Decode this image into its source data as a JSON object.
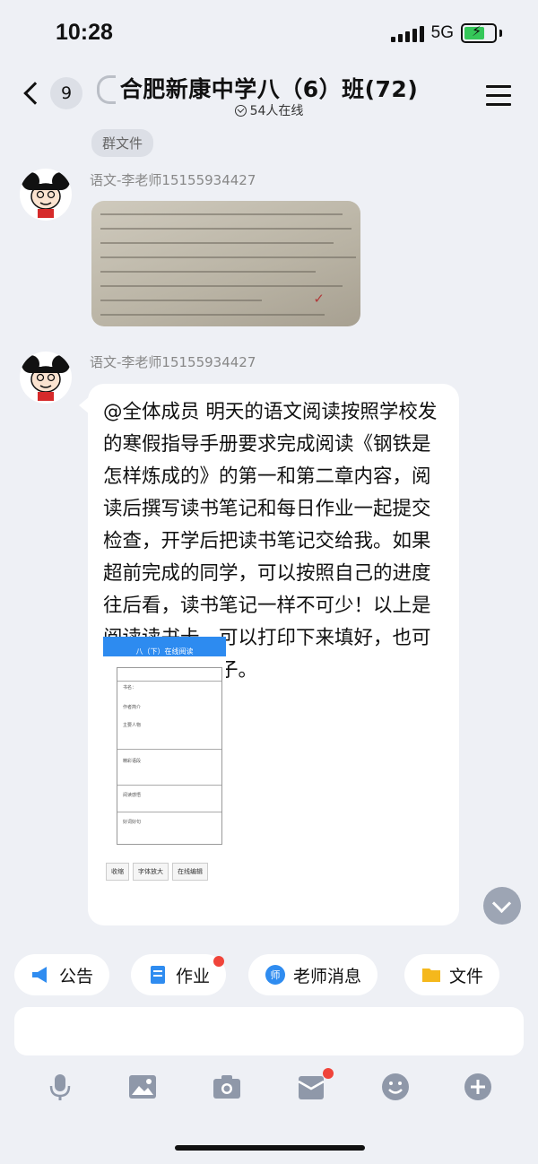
{
  "status_bar": {
    "time": "10:28",
    "network": "5G"
  },
  "header": {
    "back_badge": "9",
    "title": "合肥新康中学八（6）班(72)",
    "online": "54人在线"
  },
  "group_file_chip": "群文件",
  "messages": [
    {
      "sender": "语文-李老师15155934427",
      "type": "image"
    },
    {
      "sender": "语文-李老师15155934427",
      "type": "text",
      "text": "@全体成员 明天的语文阅读按照学校发的寒假指导手册要求完成阅读《钢铁是怎样炼成的》的第一和第二章内容，阅读后撰写读书笔记和每日作业一起提交检查，开学后把读书笔记交给我。如果超前完成的同学，可以按照自己的进度往后看，读书笔记一样不可少！以上是阅读读书卡，可以打印下来填好，也可以自己备好本子。"
    }
  ],
  "shortcuts": [
    {
      "label": "公告",
      "icon": "megaphone-icon",
      "color": "#2f8cf0"
    },
    {
      "label": "作业",
      "icon": "document-icon",
      "color": "#2f8cf0"
    },
    {
      "label": "老师消息",
      "icon": "teacher-icon",
      "color": "#2f8cf0"
    },
    {
      "label": "文件",
      "icon": "folder-icon",
      "color": "#f5b81c"
    }
  ],
  "colors": {
    "accent": "#2f8cf0",
    "badge_red": "#f0443a",
    "background": "#eef0f5"
  }
}
